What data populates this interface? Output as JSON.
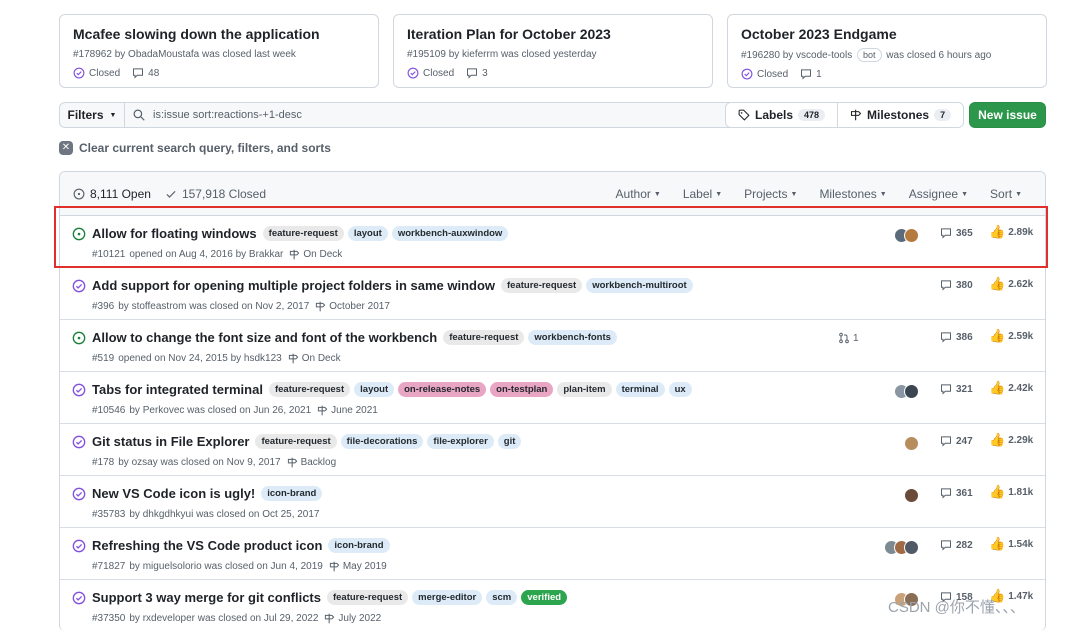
{
  "cards": [
    {
      "title": "Mcafee slowing down the application",
      "number": "#178962",
      "meta_text": "by ObadaMoustafa was closed last week",
      "bot": "",
      "meta_tail": "",
      "state": "Closed",
      "comments": "48"
    },
    {
      "title": "Iteration Plan for October 2023",
      "number": "#195109",
      "meta_text": "by kieferrm was closed yesterday",
      "bot": "",
      "meta_tail": "",
      "state": "Closed",
      "comments": "3"
    },
    {
      "title": "October 2023 Endgame",
      "number": "#196280",
      "meta_text": "by vscode-tools",
      "bot": "bot",
      "meta_tail": "was closed 6 hours ago",
      "state": "Closed",
      "comments": "1"
    }
  ],
  "toolbar": {
    "filters_label": "Filters",
    "search_value": "is:issue sort:reactions-+1-desc",
    "labels_label": "Labels",
    "labels_count": "478",
    "milestones_label": "Milestones",
    "milestones_count": "7",
    "new_issue_label": "New issue"
  },
  "clear_text": "Clear current search query, filters, and sorts",
  "header": {
    "open": "8,111 Open",
    "closed": "157,918 Closed",
    "filters": [
      "Author",
      "Label",
      "Projects",
      "Milestones",
      "Assignee",
      "Sort"
    ]
  },
  "colors": {
    "open": "#1a7f37",
    "closed": "#8250df",
    "accent_green": "#2c974b",
    "highlight": "#e0302b"
  },
  "issues": [
    {
      "title": "Allow for floating windows",
      "state": "open",
      "labels": [
        {
          "name": "feature-request",
          "bg": "#e9e9ea",
          "fg": "#24292f"
        },
        {
          "name": "layout",
          "bg": "#dcebf7",
          "fg": "#24292f"
        },
        {
          "name": "workbench-auxwindow",
          "bg": "#dcebf7",
          "fg": "#24292f"
        }
      ],
      "number": "#10121",
      "meta": "opened on Aug 4, 2016 by Brakkar",
      "milestone": "On Deck",
      "avatars": [
        "#5b6b7b",
        "#b57a3e"
      ],
      "linked_prs": "",
      "comments": "365",
      "reactions": "2.89k"
    },
    {
      "title": "Add support for opening multiple project folders in same window",
      "state": "closed",
      "labels": [
        {
          "name": "feature-request",
          "bg": "#e9e9ea",
          "fg": "#24292f"
        },
        {
          "name": "workbench-multiroot",
          "bg": "#dcebf7",
          "fg": "#24292f"
        }
      ],
      "number": "#396",
      "meta": "by stoffeastrom was closed on Nov 2, 2017",
      "milestone": "October 2017",
      "avatars": [],
      "linked_prs": "",
      "comments": "380",
      "reactions": "2.62k"
    },
    {
      "title": "Allow to change the font size and font of the workbench",
      "state": "open",
      "labels": [
        {
          "name": "feature-request",
          "bg": "#e9e9ea",
          "fg": "#24292f"
        },
        {
          "name": "workbench-fonts",
          "bg": "#dcebf7",
          "fg": "#24292f"
        }
      ],
      "number": "#519",
      "meta": "opened on Nov 24, 2015 by hsdk123",
      "milestone": "On Deck",
      "avatars": [],
      "linked_prs": "1",
      "comments": "386",
      "reactions": "2.59k"
    },
    {
      "title": "Tabs for integrated terminal",
      "state": "closed",
      "labels": [
        {
          "name": "feature-request",
          "bg": "#e9e9ea",
          "fg": "#24292f"
        },
        {
          "name": "layout",
          "bg": "#dcebf7",
          "fg": "#24292f"
        },
        {
          "name": "on-release-notes",
          "bg": "#e8a5c4",
          "fg": "#24292f"
        },
        {
          "name": "on-testplan",
          "bg": "#e8a5c4",
          "fg": "#24292f"
        },
        {
          "name": "plan-item",
          "bg": "#e9e9ea",
          "fg": "#24292f"
        },
        {
          "name": "terminal",
          "bg": "#dcebf7",
          "fg": "#24292f"
        },
        {
          "name": "ux",
          "bg": "#dcebf7",
          "fg": "#24292f"
        }
      ],
      "number": "#10546",
      "meta": "by Perkovec was closed on Jun 26, 2021",
      "milestone": "June 2021",
      "avatars": [
        "#8a96a3",
        "#3c4652"
      ],
      "linked_prs": "",
      "comments": "321",
      "reactions": "2.42k"
    },
    {
      "title": "Git status in File Explorer",
      "state": "closed",
      "labels": [
        {
          "name": "feature-request",
          "bg": "#e9e9ea",
          "fg": "#24292f"
        },
        {
          "name": "file-decorations",
          "bg": "#dcebf7",
          "fg": "#24292f"
        },
        {
          "name": "file-explorer",
          "bg": "#dcebf7",
          "fg": "#24292f"
        },
        {
          "name": "git",
          "bg": "#dcebf7",
          "fg": "#24292f"
        }
      ],
      "number": "#178",
      "meta": "by ozsay was closed on Nov 9, 2017",
      "milestone": "Backlog",
      "avatars": [
        "#b88d5e"
      ],
      "linked_prs": "",
      "comments": "247",
      "reactions": "2.29k"
    },
    {
      "title": "New VS Code icon is ugly!",
      "state": "closed",
      "labels": [
        {
          "name": "icon-brand",
          "bg": "#dcebf7",
          "fg": "#24292f"
        }
      ],
      "number": "#35783",
      "meta": "by dhkgdhkyui was closed on Oct 25, 2017",
      "milestone": "",
      "avatars": [
        "#6b4a3a"
      ],
      "linked_prs": "",
      "comments": "361",
      "reactions": "1.81k"
    },
    {
      "title": "Refreshing the VS Code product icon",
      "state": "closed",
      "labels": [
        {
          "name": "icon-brand",
          "bg": "#dcebf7",
          "fg": "#24292f"
        }
      ],
      "number": "#71827",
      "meta": "by miguelsolorio was closed on Jun 4, 2019",
      "milestone": "May 2019",
      "avatars": [
        "#7d8a92",
        "#a06a45",
        "#4f5a66"
      ],
      "linked_prs": "",
      "comments": "282",
      "reactions": "1.54k"
    },
    {
      "title": "Support 3 way merge for git conflicts",
      "state": "closed",
      "labels": [
        {
          "name": "feature-request",
          "bg": "#e9e9ea",
          "fg": "#24292f"
        },
        {
          "name": "merge-editor",
          "bg": "#dcebf7",
          "fg": "#24292f"
        },
        {
          "name": "scm",
          "bg": "#dcebf7",
          "fg": "#24292f"
        },
        {
          "name": "verified",
          "bg": "#2da44e",
          "fg": "#ffffff"
        }
      ],
      "number": "#37350",
      "meta": "by rxdeveloper was closed on Jul 29, 2022",
      "milestone": "July 2022",
      "avatars": [
        "#c9a27a",
        "#8a6d55"
      ],
      "linked_prs": "",
      "comments": "158",
      "reactions": "1.47k"
    }
  ],
  "watermark": "CSDN @你不懂、、、"
}
